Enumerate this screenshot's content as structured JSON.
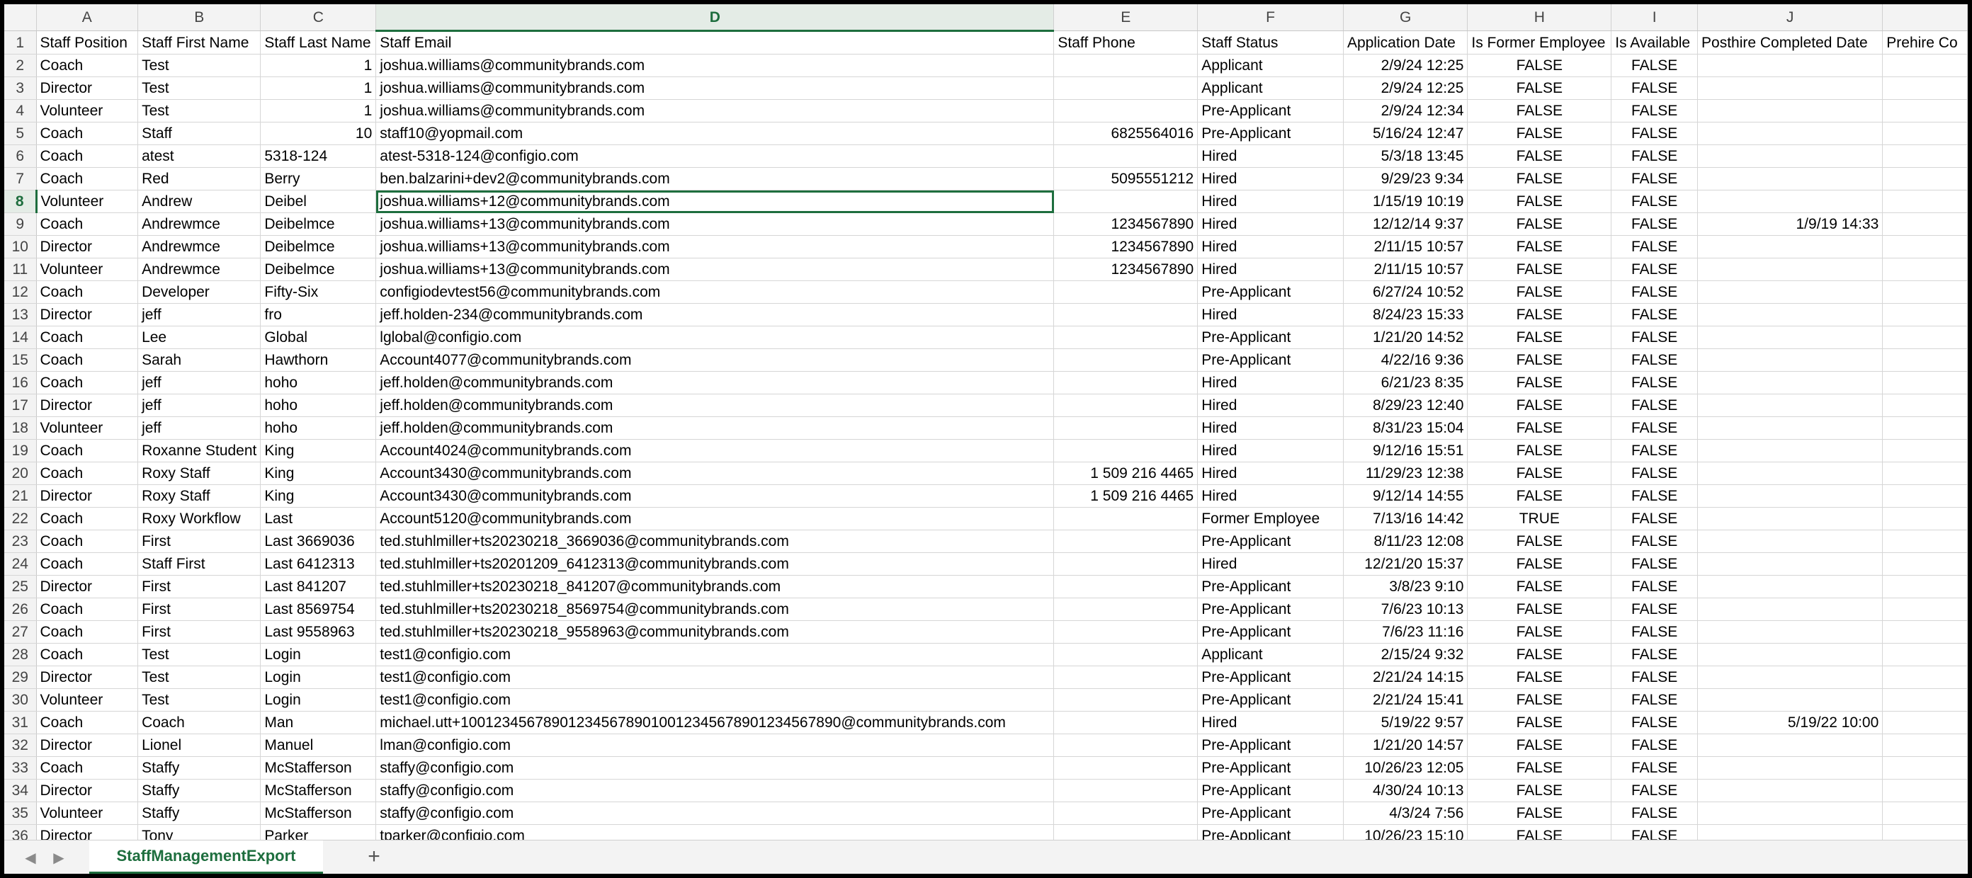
{
  "columns": [
    "A",
    "B",
    "C",
    "D",
    "E",
    "F",
    "G",
    "H",
    "I",
    "J",
    ""
  ],
  "selected_column": "D",
  "selected_row": "8",
  "rows": [
    {
      "n": "1",
      "cells": [
        "Staff Position",
        "Staff First Name",
        "Staff Last Name",
        "Staff Email",
        "Staff Phone",
        "Staff Status",
        "Application Date",
        "Is Former Employee",
        "Is Available",
        "Posthire Completed Date",
        "Prehire Co"
      ]
    },
    {
      "n": "2",
      "cells": [
        "Coach",
        "Test",
        "1",
        "joshua.williams@communitybrands.com",
        "",
        "Applicant",
        "2/9/24 12:25",
        "FALSE",
        "FALSE",
        "",
        ""
      ]
    },
    {
      "n": "3",
      "cells": [
        "Director",
        "Test",
        "1",
        "joshua.williams@communitybrands.com",
        "",
        "Applicant",
        "2/9/24 12:25",
        "FALSE",
        "FALSE",
        "",
        ""
      ]
    },
    {
      "n": "4",
      "cells": [
        "Volunteer",
        "Test",
        "1",
        "joshua.williams@communitybrands.com",
        "",
        "Pre-Applicant",
        "2/9/24 12:34",
        "FALSE",
        "FALSE",
        "",
        ""
      ]
    },
    {
      "n": "5",
      "cells": [
        "Coach",
        "Staff",
        "10",
        "staff10@yopmail.com",
        "6825564016",
        "Pre-Applicant",
        "5/16/24 12:47",
        "FALSE",
        "FALSE",
        "",
        ""
      ]
    },
    {
      "n": "6",
      "cells": [
        "Coach",
        "atest",
        "5318-124",
        "atest-5318-124@configio.com",
        "",
        "Hired",
        "5/3/18 13:45",
        "FALSE",
        "FALSE",
        "",
        ""
      ]
    },
    {
      "n": "7",
      "cells": [
        "Coach",
        "Red",
        "Berry",
        "ben.balzarini+dev2@communitybrands.com",
        "5095551212",
        "Hired",
        "9/29/23 9:34",
        "FALSE",
        "FALSE",
        "",
        ""
      ]
    },
    {
      "n": "8",
      "cells": [
        "Volunteer",
        "Andrew",
        "Deibel",
        "joshua.williams+12@communitybrands.com",
        "",
        "Hired",
        "1/15/19 10:19",
        "FALSE",
        "FALSE",
        "",
        ""
      ]
    },
    {
      "n": "9",
      "cells": [
        "Coach",
        "Andrewmce",
        "Deibelmce",
        "joshua.williams+13@communitybrands.com",
        "1234567890",
        "Hired",
        "12/12/14 9:37",
        "FALSE",
        "FALSE",
        "1/9/19 14:33",
        ""
      ]
    },
    {
      "n": "10",
      "cells": [
        "Director",
        "Andrewmce",
        "Deibelmce",
        "joshua.williams+13@communitybrands.com",
        "1234567890",
        "Hired",
        "2/11/15 10:57",
        "FALSE",
        "FALSE",
        "",
        ""
      ]
    },
    {
      "n": "11",
      "cells": [
        "Volunteer",
        "Andrewmce",
        "Deibelmce",
        "joshua.williams+13@communitybrands.com",
        "1234567890",
        "Hired",
        "2/11/15 10:57",
        "FALSE",
        "FALSE",
        "",
        ""
      ]
    },
    {
      "n": "12",
      "cells": [
        "Coach",
        "Developer",
        "Fifty-Six",
        "configiodevtest56@communitybrands.com",
        "",
        "Pre-Applicant",
        "6/27/24 10:52",
        "FALSE",
        "FALSE",
        "",
        ""
      ]
    },
    {
      "n": "13",
      "cells": [
        "Director",
        "jeff",
        "fro",
        "jeff.holden-234@communitybrands.com",
        "",
        "Hired",
        "8/24/23 15:33",
        "FALSE",
        "FALSE",
        "",
        ""
      ]
    },
    {
      "n": "14",
      "cells": [
        "Coach",
        "Lee",
        "Global",
        "lglobal@configio.com",
        "",
        "Pre-Applicant",
        "1/21/20 14:52",
        "FALSE",
        "FALSE",
        "",
        ""
      ]
    },
    {
      "n": "15",
      "cells": [
        "Coach",
        "Sarah",
        "Hawthorn",
        "Account4077@communitybrands.com",
        "",
        "Pre-Applicant",
        "4/22/16 9:36",
        "FALSE",
        "FALSE",
        "",
        ""
      ]
    },
    {
      "n": "16",
      "cells": [
        "Coach",
        "jeff",
        "hoho",
        "jeff.holden@communitybrands.com",
        "",
        "Hired",
        "6/21/23 8:35",
        "FALSE",
        "FALSE",
        "",
        ""
      ]
    },
    {
      "n": "17",
      "cells": [
        "Director",
        "jeff",
        "hoho",
        "jeff.holden@communitybrands.com",
        "",
        "Hired",
        "8/29/23 12:40",
        "FALSE",
        "FALSE",
        "",
        ""
      ]
    },
    {
      "n": "18",
      "cells": [
        "Volunteer",
        "jeff",
        "hoho",
        "jeff.holden@communitybrands.com",
        "",
        "Hired",
        "8/31/23 15:04",
        "FALSE",
        "FALSE",
        "",
        ""
      ]
    },
    {
      "n": "19",
      "cells": [
        "Coach",
        "Roxanne Student",
        "King",
        "Account4024@communitybrands.com",
        "",
        "Hired",
        "9/12/16 15:51",
        "FALSE",
        "FALSE",
        "",
        ""
      ]
    },
    {
      "n": "20",
      "cells": [
        "Coach",
        "Roxy Staff",
        "King",
        "Account3430@communitybrands.com",
        "1 509 216 4465",
        "Hired",
        "11/29/23 12:38",
        "FALSE",
        "FALSE",
        "",
        ""
      ]
    },
    {
      "n": "21",
      "cells": [
        "Director",
        "Roxy Staff",
        "King",
        "Account3430@communitybrands.com",
        "1 509 216 4465",
        "Hired",
        "9/12/14 14:55",
        "FALSE",
        "FALSE",
        "",
        ""
      ]
    },
    {
      "n": "22",
      "cells": [
        "Coach",
        "Roxy Workflow",
        "Last",
        "Account5120@communitybrands.com",
        "",
        "Former Employee",
        "7/13/16 14:42",
        "TRUE",
        "FALSE",
        "",
        ""
      ]
    },
    {
      "n": "23",
      "cells": [
        "Coach",
        "First",
        "Last 3669036",
        "ted.stuhlmiller+ts20230218_3669036@communitybrands.com",
        "",
        "Pre-Applicant",
        "8/11/23 12:08",
        "FALSE",
        "FALSE",
        "",
        ""
      ]
    },
    {
      "n": "24",
      "cells": [
        "Coach",
        "Staff First",
        "Last 6412313",
        "ted.stuhlmiller+ts20201209_6412313@communitybrands.com",
        "",
        "Hired",
        "12/21/20 15:37",
        "FALSE",
        "FALSE",
        "",
        ""
      ]
    },
    {
      "n": "25",
      "cells": [
        "Director",
        "First",
        "Last 841207",
        "ted.stuhlmiller+ts20230218_841207@communitybrands.com",
        "",
        "Pre-Applicant",
        "3/8/23 9:10",
        "FALSE",
        "FALSE",
        "",
        ""
      ]
    },
    {
      "n": "26",
      "cells": [
        "Coach",
        "First",
        "Last 8569754",
        "ted.stuhlmiller+ts20230218_8569754@communitybrands.com",
        "",
        "Pre-Applicant",
        "7/6/23 10:13",
        "FALSE",
        "FALSE",
        "",
        ""
      ]
    },
    {
      "n": "27",
      "cells": [
        "Coach",
        "First",
        "Last 9558963",
        "ted.stuhlmiller+ts20230218_9558963@communitybrands.com",
        "",
        "Pre-Applicant",
        "7/6/23 11:16",
        "FALSE",
        "FALSE",
        "",
        ""
      ]
    },
    {
      "n": "28",
      "cells": [
        "Coach",
        "Test",
        "Login",
        "test1@configio.com",
        "",
        "Applicant",
        "2/15/24 9:32",
        "FALSE",
        "FALSE",
        "",
        ""
      ]
    },
    {
      "n": "29",
      "cells": [
        "Director",
        "Test",
        "Login",
        "test1@configio.com",
        "",
        "Pre-Applicant",
        "2/21/24 14:15",
        "FALSE",
        "FALSE",
        "",
        ""
      ]
    },
    {
      "n": "30",
      "cells": [
        "Volunteer",
        "Test",
        "Login",
        "test1@configio.com",
        "",
        "Pre-Applicant",
        "2/21/24 15:41",
        "FALSE",
        "FALSE",
        "",
        ""
      ]
    },
    {
      "n": "31",
      "cells": [
        "Coach",
        "Coach",
        "Man",
        "michael.utt+10012345678901234567890100123456789012345678​90@communitybrands.com",
        "",
        "Hired",
        "5/19/22 9:57",
        "FALSE",
        "FALSE",
        "5/19/22 10:00",
        ""
      ]
    },
    {
      "n": "32",
      "cells": [
        "Director",
        "Lionel",
        "Manuel",
        "lman@configio.com",
        "",
        "Pre-Applicant",
        "1/21/20 14:57",
        "FALSE",
        "FALSE",
        "",
        ""
      ]
    },
    {
      "n": "33",
      "cells": [
        "Coach",
        "Staffy",
        "McStafferson",
        "staffy@configio.com",
        "",
        "Pre-Applicant",
        "10/26/23 12:05",
        "FALSE",
        "FALSE",
        "",
        ""
      ]
    },
    {
      "n": "34",
      "cells": [
        "Director",
        "Staffy",
        "McStafferson",
        "staffy@configio.com",
        "",
        "Pre-Applicant",
        "4/30/24 10:13",
        "FALSE",
        "FALSE",
        "",
        ""
      ]
    },
    {
      "n": "35",
      "cells": [
        "Volunteer",
        "Staffy",
        "McStafferson",
        "staffy@configio.com",
        "",
        "Pre-Applicant",
        "4/3/24 7:56",
        "FALSE",
        "FALSE",
        "",
        ""
      ]
    },
    {
      "n": "36",
      "cells": [
        "Director",
        "Tony",
        "Parker",
        "tparker@configio.com",
        "",
        "Pre-Applicant",
        "10/26/23 15:10",
        "FALSE",
        "FALSE",
        "",
        ""
      ]
    }
  ],
  "sheet_tab": {
    "label": "StaffManagementExport"
  },
  "add_sheet": "+",
  "nav": {
    "prev": "◀",
    "next": "▶"
  }
}
